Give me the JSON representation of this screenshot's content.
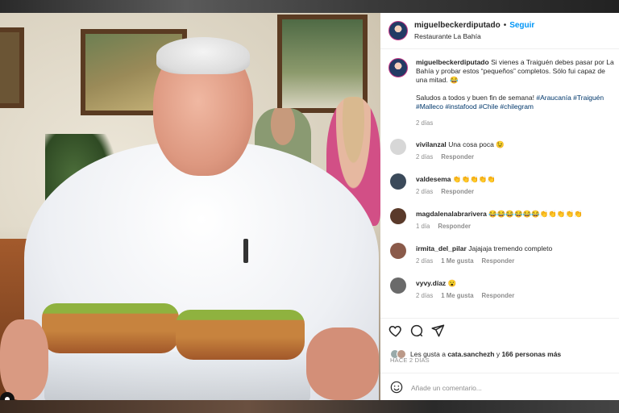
{
  "header": {
    "username": "miguelbeckerdiputado",
    "separator": "•",
    "follow_label": "Seguir",
    "location": "Restaurante La Bahía"
  },
  "caption": {
    "username": "miguelbeckerdiputado",
    "text": "Si vienes a Traiguén debes pasar por La Bahía y probar estos “pequeños” completos. Sólo fui capaz de una mitad. 😂",
    "text2": "Saludos a todos y buen fin de semana!",
    "hashtags": "#Araucanía #Traiguén #Malleco #instafood #Chile #chilegram",
    "time": "2 días"
  },
  "comments": [
    {
      "username": "vivilanzal",
      "text": "Una cosa poca 😉",
      "time": "2 días",
      "likes": "",
      "reply": "Responder"
    },
    {
      "username": "valdesema",
      "text": "👏👏👏👏👏",
      "time": "2 días",
      "likes": "",
      "reply": "Responder"
    },
    {
      "username": "magdalenalabrarivera",
      "text": "😂😂😂😂😂😂👏👏👏👏👏",
      "time": "1 día",
      "likes": "",
      "reply": "Responder"
    },
    {
      "username": "irmita_del_pilar",
      "text": "Jajajaja tremendo completo",
      "time": "2 días",
      "likes": "1 Me gusta",
      "reply": "Responder"
    },
    {
      "username": "vyvy.díaz",
      "text": "😮",
      "time": "2 días",
      "likes": "1 Me gusta",
      "reply": "Responder"
    }
  ],
  "likes": {
    "prefix": "Les gusta a",
    "user": "cata.sanchezh",
    "joiner": "y",
    "others": "166 personas más"
  },
  "post_time": "HACE 2 DÍAS",
  "comment_input": {
    "placeholder": "Añade un comentario..."
  },
  "icons": [
    "heart-icon",
    "comment-icon",
    "share-icon",
    "emoji-icon",
    "user-tag-icon"
  ],
  "colors": {
    "follow": "#0095f6",
    "hashtag": "#00376b",
    "text": "#262626",
    "muted": "#8e8e8e"
  }
}
